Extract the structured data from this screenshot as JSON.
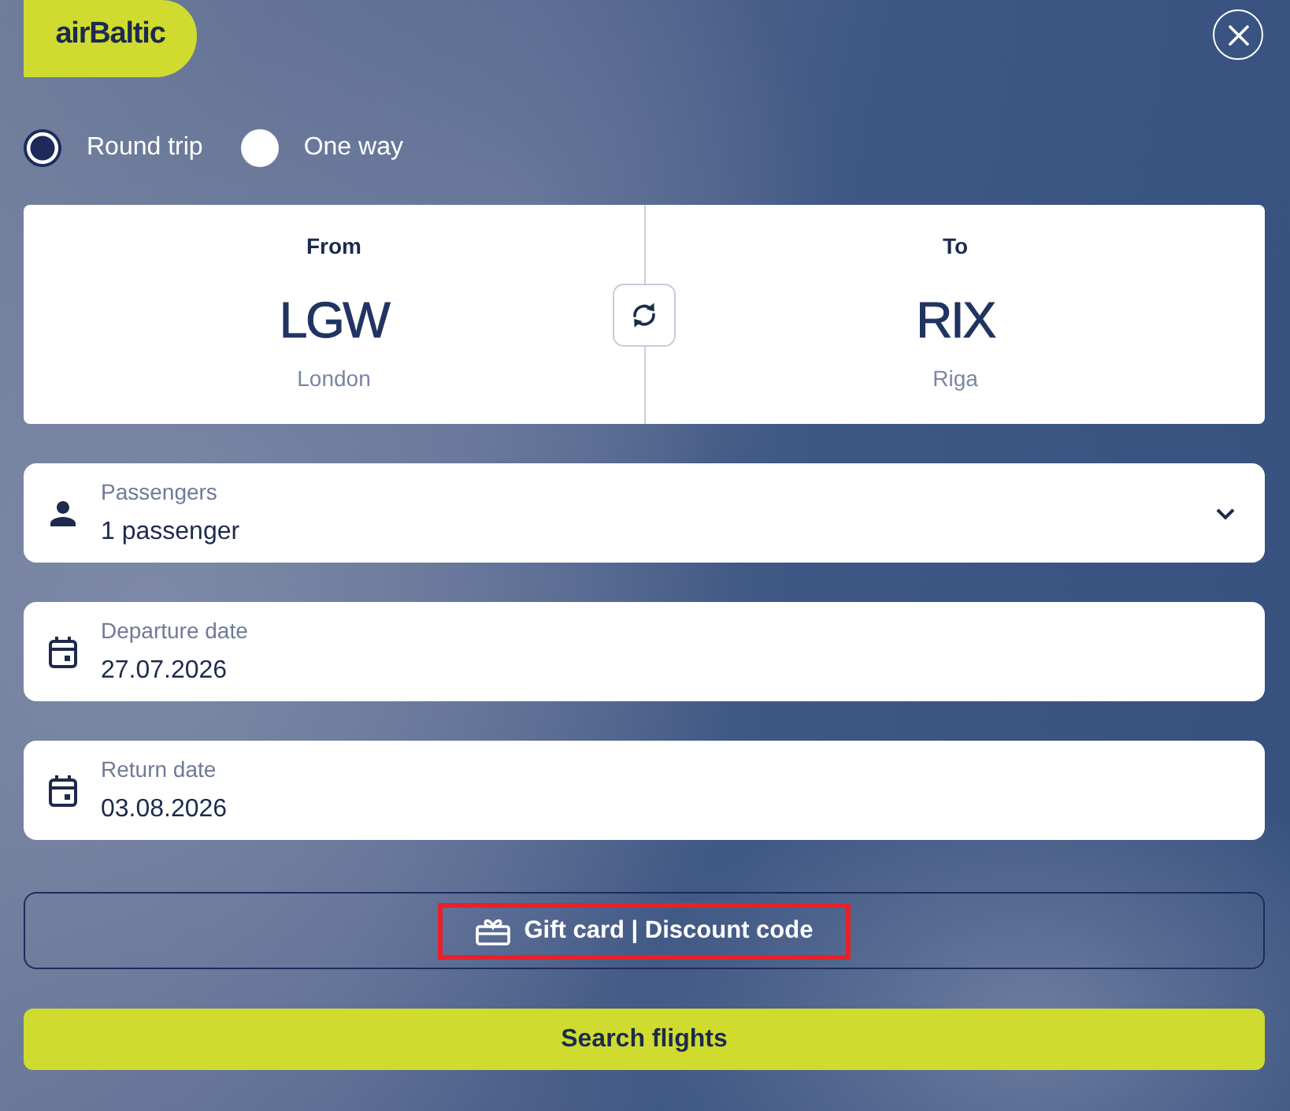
{
  "logo": {
    "text": "airBaltic"
  },
  "trip_types": [
    {
      "label": "Round trip",
      "selected": true
    },
    {
      "label": "One way",
      "selected": false
    }
  ],
  "airports": [
    {
      "label": "From",
      "code": "LGW",
      "city": "London"
    },
    {
      "label": "To",
      "code": "RIX",
      "city": "Riga"
    }
  ],
  "fields": [
    {
      "kind": "passengers",
      "label": "Passengers",
      "value": "1 passenger"
    },
    {
      "kind": "date",
      "label": "Departure date",
      "value": "27.07.2026"
    },
    {
      "kind": "date",
      "label": "Return date",
      "value": "03.08.2026"
    }
  ],
  "gift_card_button": {
    "label": "Gift card | Discount code",
    "highlighted": true
  },
  "search_button": {
    "label": "Search flights"
  }
}
